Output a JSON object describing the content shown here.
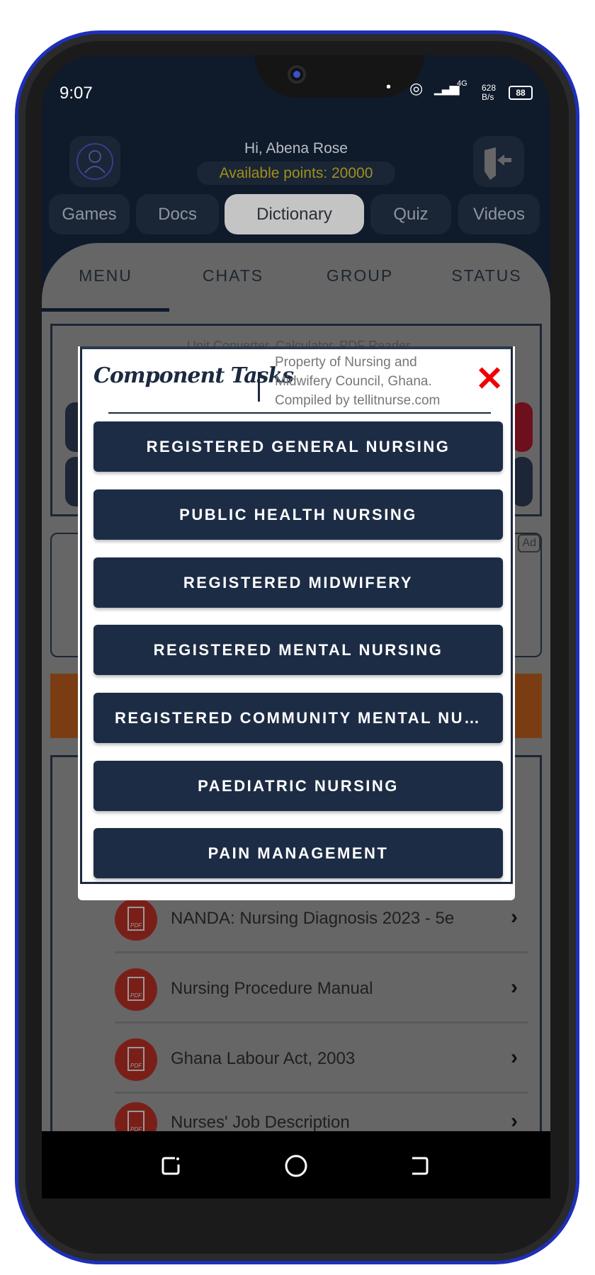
{
  "status_bar": {
    "time": "9:07",
    "network": "4G",
    "speed": "628 B/s",
    "battery": "88"
  },
  "header": {
    "greeting": "Hi, Abena Rose",
    "points": "Available points: 20000",
    "avatar_icon": "user-icon",
    "logout_icon": "logout-door-icon"
  },
  "top_tabs": [
    {
      "label": "Games"
    },
    {
      "label": "Docs"
    },
    {
      "label": "Dictionary",
      "active": true
    },
    {
      "label": "Quiz"
    },
    {
      "label": "Videos"
    }
  ],
  "menu_tabs": [
    {
      "label": "MENU",
      "active": true
    },
    {
      "label": "CHATS"
    },
    {
      "label": "GROUP"
    },
    {
      "label": "STATUS"
    }
  ],
  "background": {
    "tools_subtitle": "Unit Converter, Calculator, PDF Reader",
    "ad_label": "Ad"
  },
  "modal": {
    "title": "Component Tasks",
    "property": [
      "Property of Nursing and",
      "Midwifery Council, Ghana.",
      "Compiled by tellitnurse.com"
    ],
    "close_icon": "close-x-icon",
    "close_color": "#e00000",
    "buttons": [
      {
        "label": "REGISTERED GENERAL NURSING"
      },
      {
        "label": "PUBLIC HEALTH NURSING"
      },
      {
        "label": "REGISTERED MIDWIFERY"
      },
      {
        "label": "REGISTERED MENTAL NURSING"
      },
      {
        "label": "REGISTERED COMMUNITY MENTAL NURSING"
      },
      {
        "label": "PAEDIATRIC NURSING"
      },
      {
        "label": "PAIN MANAGEMENT"
      }
    ]
  },
  "documents": [
    {
      "title": "NANDA: Nursing Diagnosis 2023 - 5e",
      "icon": "pdf-icon"
    },
    {
      "title": "Nursing Procedure Manual",
      "icon": "pdf-icon"
    },
    {
      "title": "Ghana Labour Act, 2003",
      "icon": "pdf-icon"
    },
    {
      "title": "Nurses' Job Description",
      "icon": "pdf-icon"
    }
  ],
  "colors": {
    "accent": "#1c2c45",
    "points": "#d4b81f",
    "pdf": "#c0392b"
  }
}
